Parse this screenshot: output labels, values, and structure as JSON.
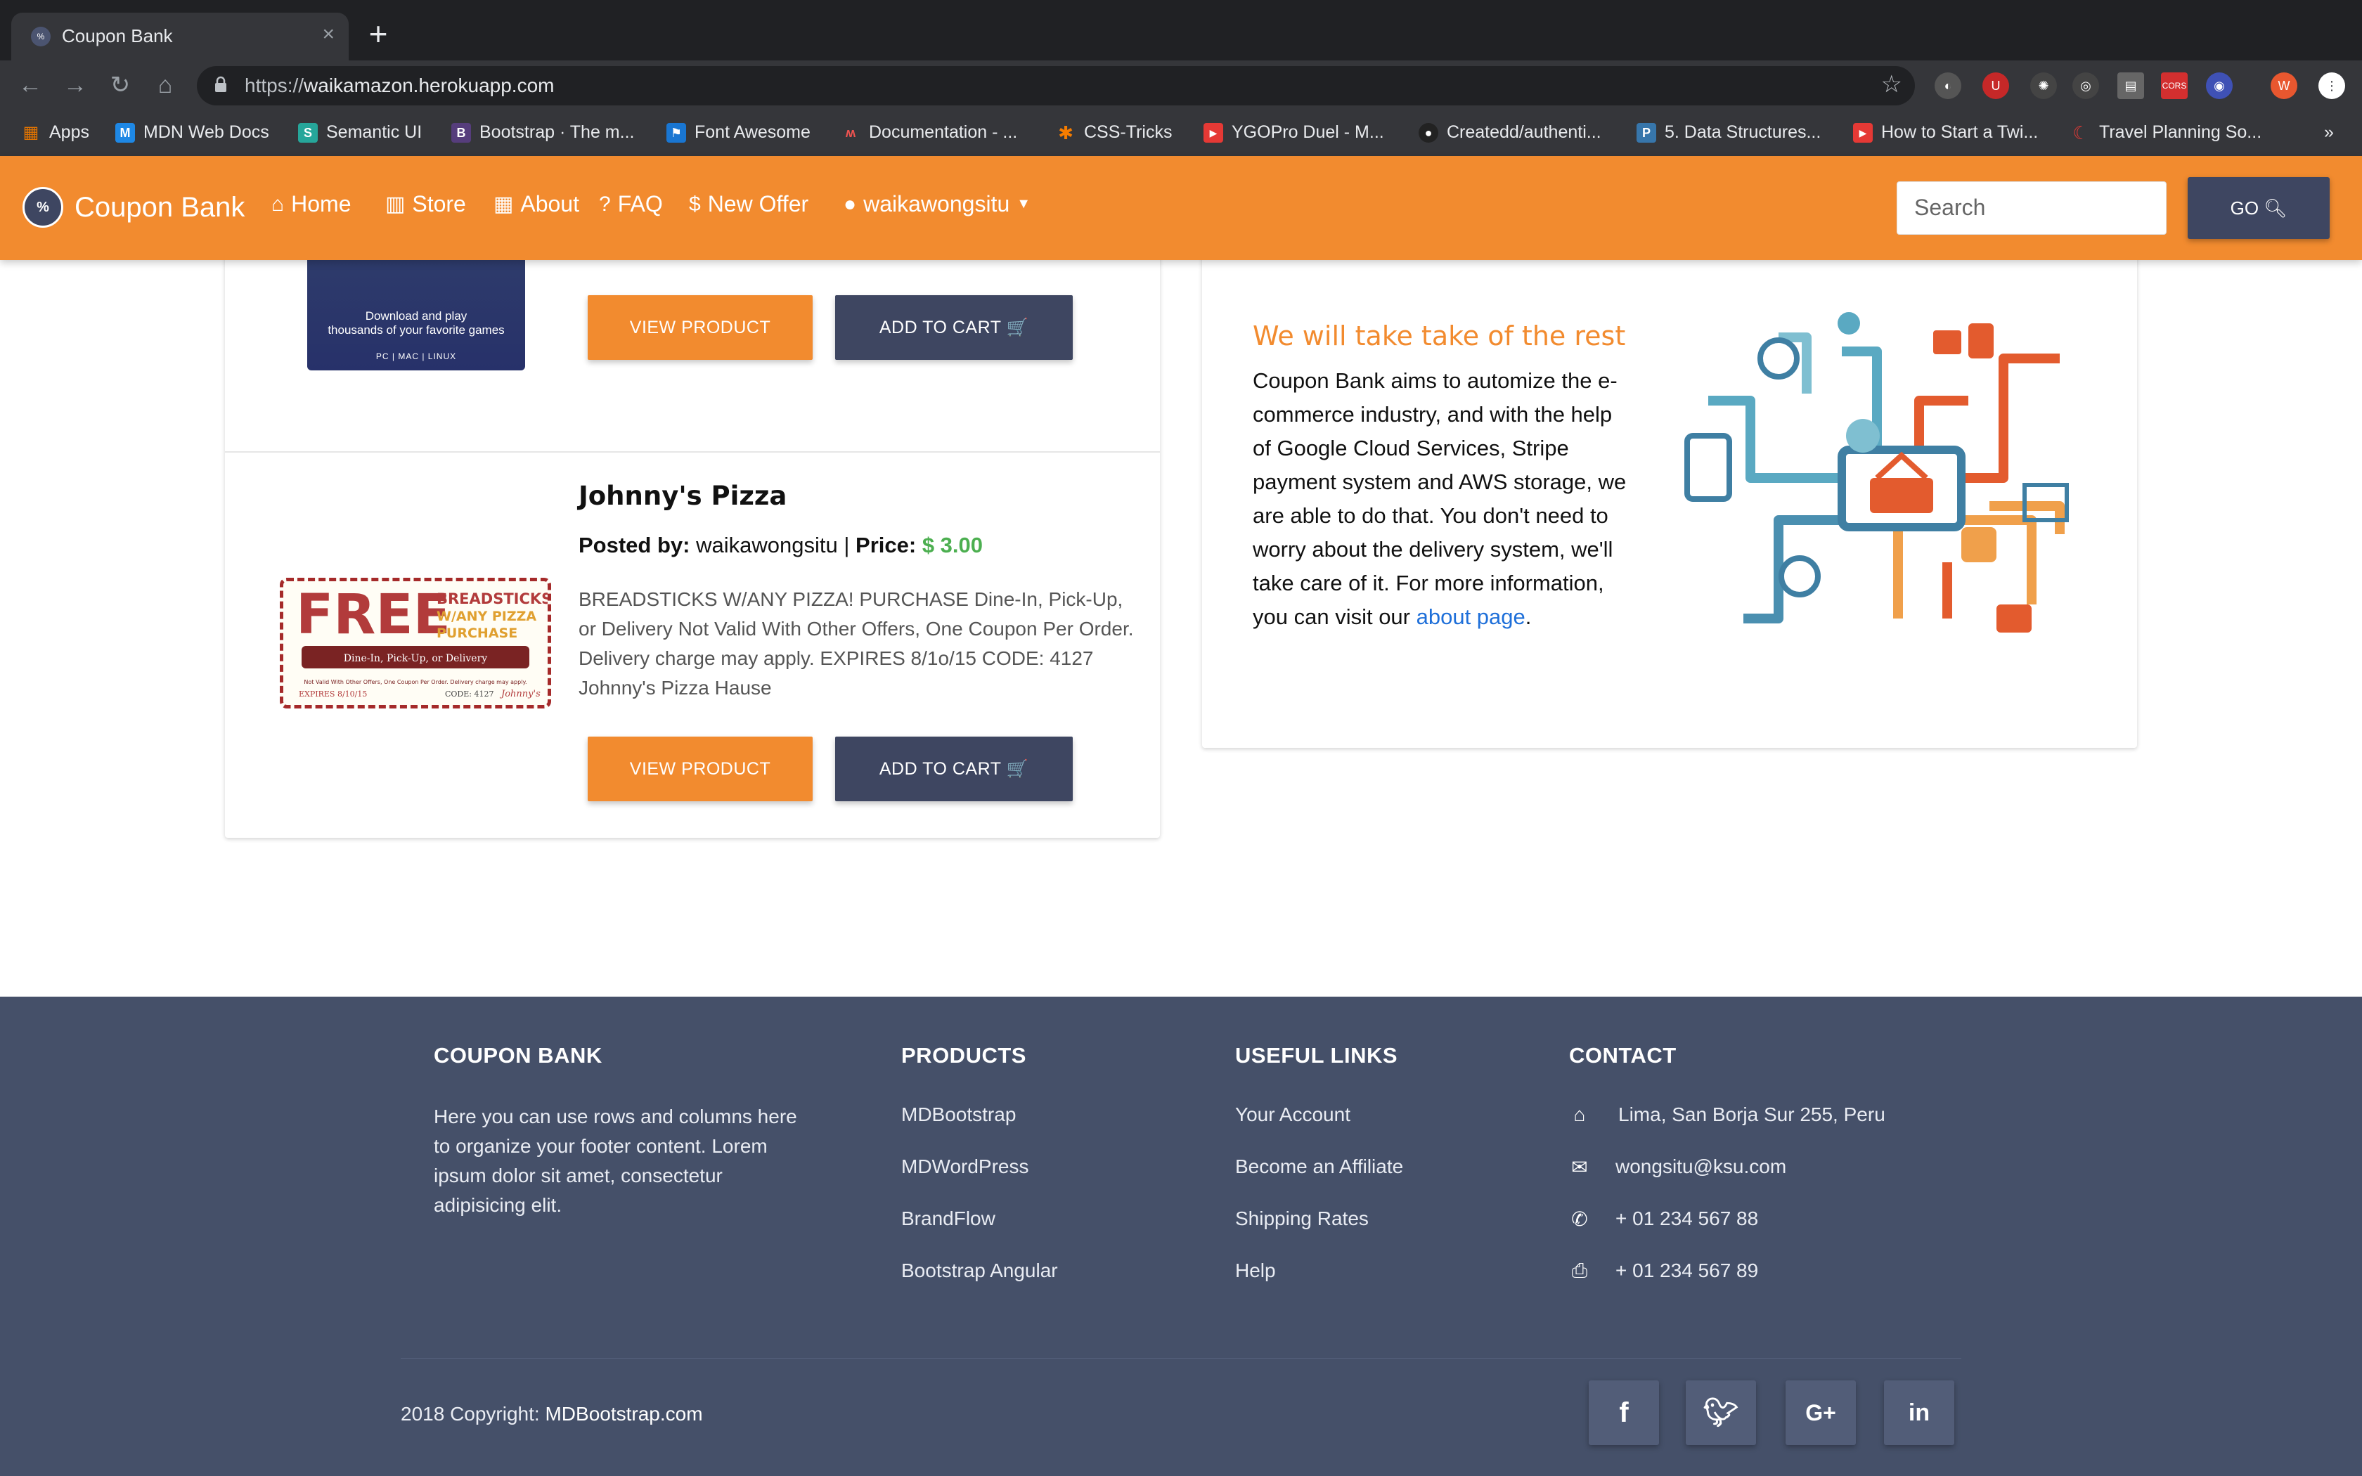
{
  "browser": {
    "tab_title": "Coupon Bank",
    "tab_close": "×",
    "new_tab": "+",
    "url_prefix": "https://",
    "url_host": "waikamazon.herokuapp.com",
    "bookmarks_overflow": "»",
    "profile_initial": "W",
    "bookmarks": [
      "Apps",
      "MDN Web Docs",
      "Semantic UI",
      "Bootstrap · The m...",
      "Font Awesome",
      "Documentation - ...",
      "CSS-Tricks",
      "YGOPro Duel - M...",
      "Createdd/authenti...",
      "5. Data Structures...",
      "How to Start a Twi...",
      "Travel Planning So..."
    ]
  },
  "nav": {
    "brand": "Coupon Bank",
    "links": [
      "Home",
      "Store",
      "About",
      "FAQ",
      "New Offer"
    ],
    "user": "waikawongsitu",
    "search_placeholder": "Search",
    "go_label": "GO"
  },
  "products": {
    "steam_line1": "Download and play",
    "steam_line2": "thousands of your favorite games",
    "steam_platforms": "PC  |  MAC  |  LINUX",
    "view_label": "VIEW PRODUCT",
    "cart_label": "ADD TO CART",
    "item": {
      "title": "Johnny's Pizza",
      "posted_label": "Posted by:",
      "author": "waikawongsitu",
      "sep": "|",
      "price_label": "Price:",
      "price": "$ 3.00",
      "description": "BREADSTICKS W/ANY PIZZA! PURCHASE Dine-In, Pick-Up, or Delivery Not Valid With Other Offers, One Coupon Per Order. Delivery charge may apply. EXPIRES 8/1o/15 CODE: 4127 Johnny's Pizza Hause",
      "coupon_free": "FREE",
      "coupon_l1": "BREADSTICKS",
      "coupon_l2": "W/ANY PIZZA",
      "coupon_l3": "PURCHASE",
      "coupon_band": "Dine-In, Pick-Up, or Delivery",
      "coupon_fine": "Not Valid With Other Offers, One Coupon Per Order. Delivery charge may apply.",
      "coupon_exp": "EXPIRES 8/10/15",
      "coupon_code": "CODE: 4127",
      "coupon_brand": "Johnny's"
    }
  },
  "info": {
    "title": "We will take take of the rest",
    "text": "Coupon Bank aims to automize the e-commerce industry, and with the help of Google Cloud Services, Stripe payment system and AWS storage, we are able to do that. You don't need to worry about the delivery system, we'll take care of it. For more information, you can visit our ",
    "link": "about page",
    "end": "."
  },
  "footer": {
    "col1_title": "COUPON BANK",
    "col1_text": "Here you can use rows and columns here to organize your footer content. Lorem ipsum dolor sit amet, consectetur adipisicing elit.",
    "col2_title": "PRODUCTS",
    "col2_links": [
      "MDBootstrap",
      "MDWordPress",
      "BrandFlow",
      "Bootstrap Angular"
    ],
    "col3_title": "USEFUL LINKS",
    "col3_links": [
      "Your Account",
      "Become an Affiliate",
      "Shipping Rates",
      "Help"
    ],
    "col4_title": "CONTACT",
    "address": "Lima, San Borja Sur 255, Peru",
    "email": "wongsitu@ksu.com",
    "phone": "+ 01 234 567 88",
    "fax": "+ 01 234 567 89",
    "copyright_prefix": "2018 Copyright:",
    "copyright_link": "MDBootstrap.com",
    "social": [
      "facebook-icon",
      "twitter-icon",
      "google-plus-icon",
      "linkedin-icon"
    ]
  },
  "colors": {
    "brand_orange": "#f28b2f",
    "navy": "#3e4661",
    "footer": "#455069",
    "price_green": "#4caf50",
    "link_blue": "#1e6fd9"
  }
}
